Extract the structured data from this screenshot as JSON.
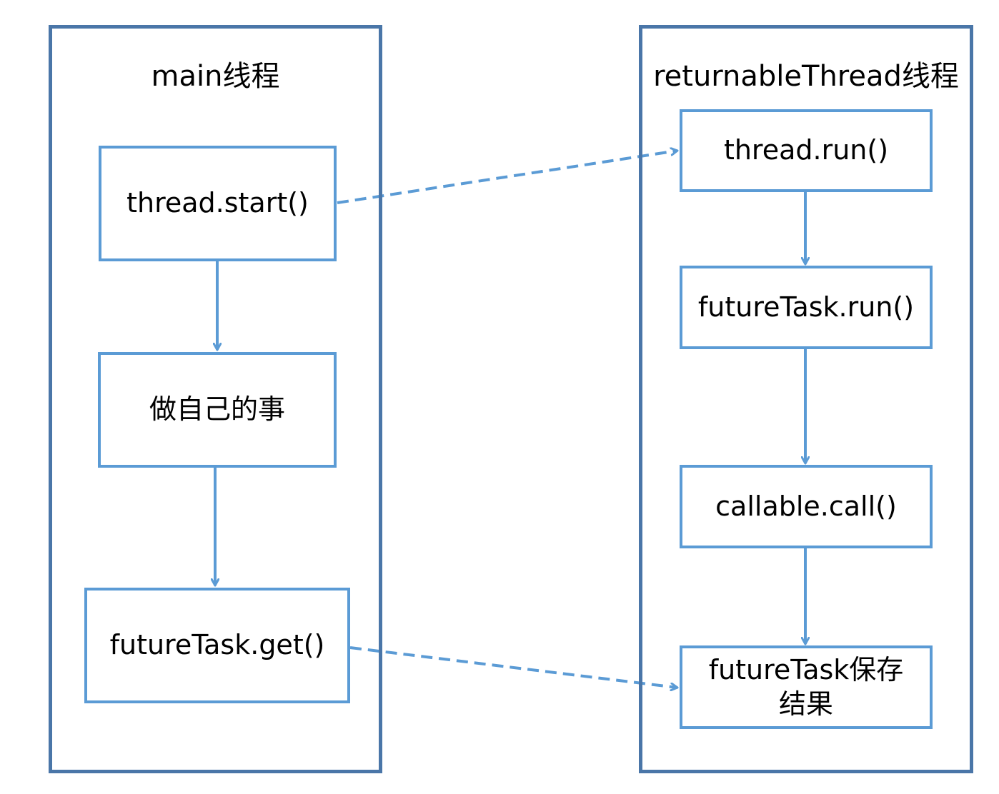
{
  "lanes": {
    "main": {
      "title": "main线程"
    },
    "worker": {
      "title": "returnableThread线程"
    }
  },
  "main_steps": {
    "start": "thread.start()",
    "own_work": "做自己的事",
    "get": "futureTask.get()"
  },
  "worker_steps": {
    "run": "thread.run()",
    "future_run": "futureTask.run()",
    "call": "callable.call()",
    "save_line1": "futureTask保存",
    "save_line2": "结果"
  },
  "colors": {
    "lane_border": "#4a76a8",
    "box_border": "#5b9bd5",
    "arrow": "#5b9bd5"
  }
}
